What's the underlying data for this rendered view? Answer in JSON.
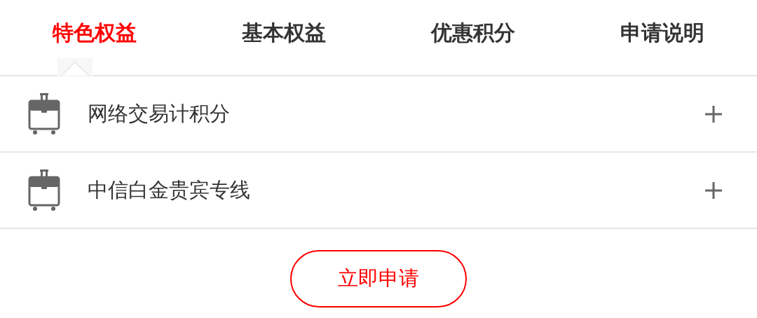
{
  "tabs": [
    {
      "label": "特色权益",
      "selected": true
    },
    {
      "label": "基本权益",
      "selected": false
    },
    {
      "label": "优惠积分",
      "selected": false
    },
    {
      "label": "申请说明",
      "selected": false
    }
  ],
  "items": [
    {
      "title": "网络交易计积分",
      "expanded": false
    },
    {
      "title": "中信白金贵宾专线",
      "expanded": false
    }
  ],
  "apply_button": "立即申请"
}
